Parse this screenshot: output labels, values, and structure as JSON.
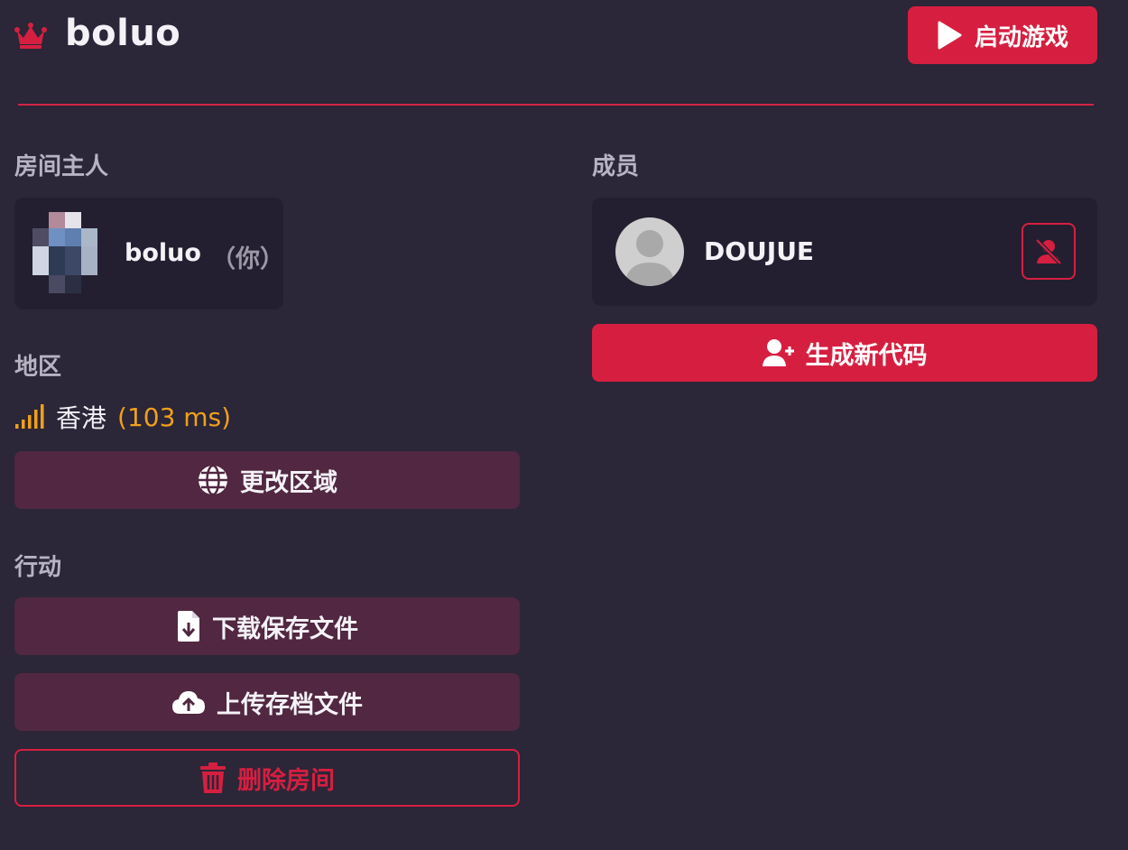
{
  "header": {
    "room_name": "boluo",
    "start_label": "启动游戏"
  },
  "owner": {
    "section_label": "房间主人",
    "name": "boluo",
    "you_tag": "（你）"
  },
  "region": {
    "section_label": "地区",
    "name": "香港",
    "ping": "(103 ms)",
    "change_label": "更改区域"
  },
  "actions": {
    "section_label": "行动",
    "download_label": "下载保存文件",
    "upload_label": "上传存档文件",
    "delete_label": "删除房间"
  },
  "members": {
    "section_label": "成员",
    "list": [
      {
        "name": "DOUJUE"
      }
    ],
    "generate_label": "生成新代码"
  },
  "icons": {
    "crown": "crown-icon",
    "play": "play-icon",
    "signal": "signal-icon",
    "globe": "globe-icon",
    "file_download": "file-download-icon",
    "cloud_upload": "cloud-upload-icon",
    "trash": "trash-icon",
    "user_slash": "user-slash-icon",
    "user_plus": "user-plus-icon"
  },
  "colors": {
    "background": "#2b2638",
    "card": "#241f30",
    "accent": "#d61f40",
    "dark_button": "#512741",
    "ping": "#f0a01c",
    "muted_label": "#b8b3c3"
  }
}
